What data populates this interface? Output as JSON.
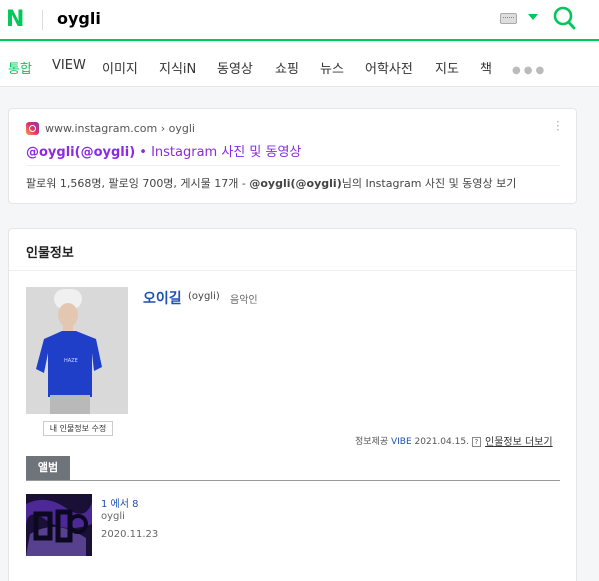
{
  "header": {
    "logo": "N",
    "query": "oygli"
  },
  "tabs": [
    "통합",
    "VIEW",
    "이미지",
    "지식iN",
    "동영상",
    "쇼핑",
    "뉴스",
    "어학사전",
    "지도",
    "책"
  ],
  "colors": {
    "accent": "#03c75a",
    "link": "#1e50b4",
    "instagram_title": "#8a2be2",
    "album_tab": "#6f737a"
  },
  "instagram": {
    "url": "www.instagram.com › oygli",
    "title_handle": "@oygli(@oygli)",
    "title_rest": " • Instagram 사진 및 동영상",
    "desc_prefix": "팔로워 1,568명, 팔로잉 700명, 게시물 17개 - ",
    "desc_handle": "@oygli(@oygli)",
    "desc_suffix": "님의 Instagram 사진 및 동영상 보기"
  },
  "profile": {
    "section_title": "인물정보",
    "name": "오이길",
    "eng_name": "(oygli)",
    "occupation": "음악인",
    "edit_button": "내 인물정보 수정",
    "provider_prefix": "정보제공 ",
    "provider_name": "VIBE",
    "provider_date": " 2021.04.15.",
    "help": "?",
    "more_link": "인물정보 더보기"
  },
  "album": {
    "tab_label": "앨범",
    "title": "1 에서 8",
    "artist": "oygli",
    "date": "2020.11.23"
  }
}
